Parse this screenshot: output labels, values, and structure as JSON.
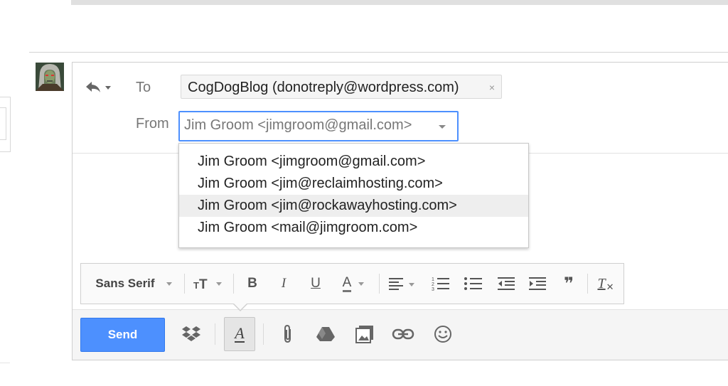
{
  "recipients": {
    "to_label": "To",
    "to_chip": "CogDogBlog (donotreply@wordpress.com)",
    "chip_remove": "×",
    "from_label": "From",
    "from_value": "Jim Groom <jimgroom@gmail.com>"
  },
  "from_dropdown": {
    "options": [
      "Jim Groom <jimgroom@gmail.com>",
      "Jim Groom <jim@reclaimhosting.com>",
      "Jim Groom <jim@rockawayhosting.com>",
      "Jim Groom <mail@jimgroom.com>"
    ],
    "highlighted_index": 2
  },
  "format_toolbar": {
    "font": "Sans Serif",
    "bold": "B",
    "italic": "I",
    "underline": "U",
    "text_color": "A",
    "quote": "❞",
    "clear_format": "T"
  },
  "bottom_toolbar": {
    "send_label": "Send",
    "format_toggle": "A",
    "icons": [
      "dropbox-icon",
      "formatting-icon",
      "attach-icon",
      "drive-icon",
      "insert-photo-icon",
      "insert-link-icon",
      "emoji-icon"
    ]
  },
  "colors": {
    "accent_blue": "#4d90fe",
    "highlight_row": "#eeeeee"
  }
}
